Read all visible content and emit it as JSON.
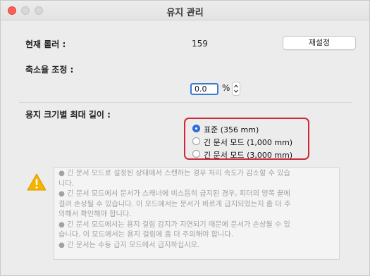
{
  "window": {
    "title": "유지 관리"
  },
  "roller": {
    "label": "현재 롤러 :",
    "count": "159",
    "reset_button": "재설정"
  },
  "scale": {
    "label": "축소율 조정 :",
    "value": "0.0",
    "unit": "%"
  },
  "paper_length": {
    "label": "용지 크기별 최대 길이 :",
    "options": [
      {
        "label": "표준 (356 mm)",
        "selected": true
      },
      {
        "label": "긴 문서 모드 (1,000 mm)",
        "selected": false
      },
      {
        "label": "긴 문서 모드 (3,000 mm)",
        "selected": false
      }
    ]
  },
  "notes": {
    "lines": [
      "● 긴 문서 모드로 설정된 상태에서 스캔하는 경우 처리 속도가 감소할 수 있습",
      "니다.",
      "● 긴 문서 모드에서 문서가 스캐너에 비스듬히 급지된 경우, 피더의 양쪽 끝에",
      "걸려 손상될 수 있습니다. 이 모드에서는 문서가 바르게 급지되었는지 좀 더 주",
      "의해서 확인해야 합니다.",
      "● 긴 문서 모드에서는 용지 걸림 감지가 지연되기 때문에 문서가 손상될 수 있",
      "습니다. 이 모드에서는 용지 걸림에 좀 더 주의해야 합니다.",
      "● 긴 문서는 수동 급지 모드에서 급지하십시오."
    ]
  },
  "colors": {
    "accent": "#2f6fde",
    "highlight": "#d0263a",
    "warning": "#f5b400"
  },
  "icons": {
    "window_close": "close-icon",
    "window_minimize": "minimize-icon",
    "window_maximize": "maximize-icon",
    "stepper": "stepper-icon",
    "warning": "warning-icon"
  }
}
